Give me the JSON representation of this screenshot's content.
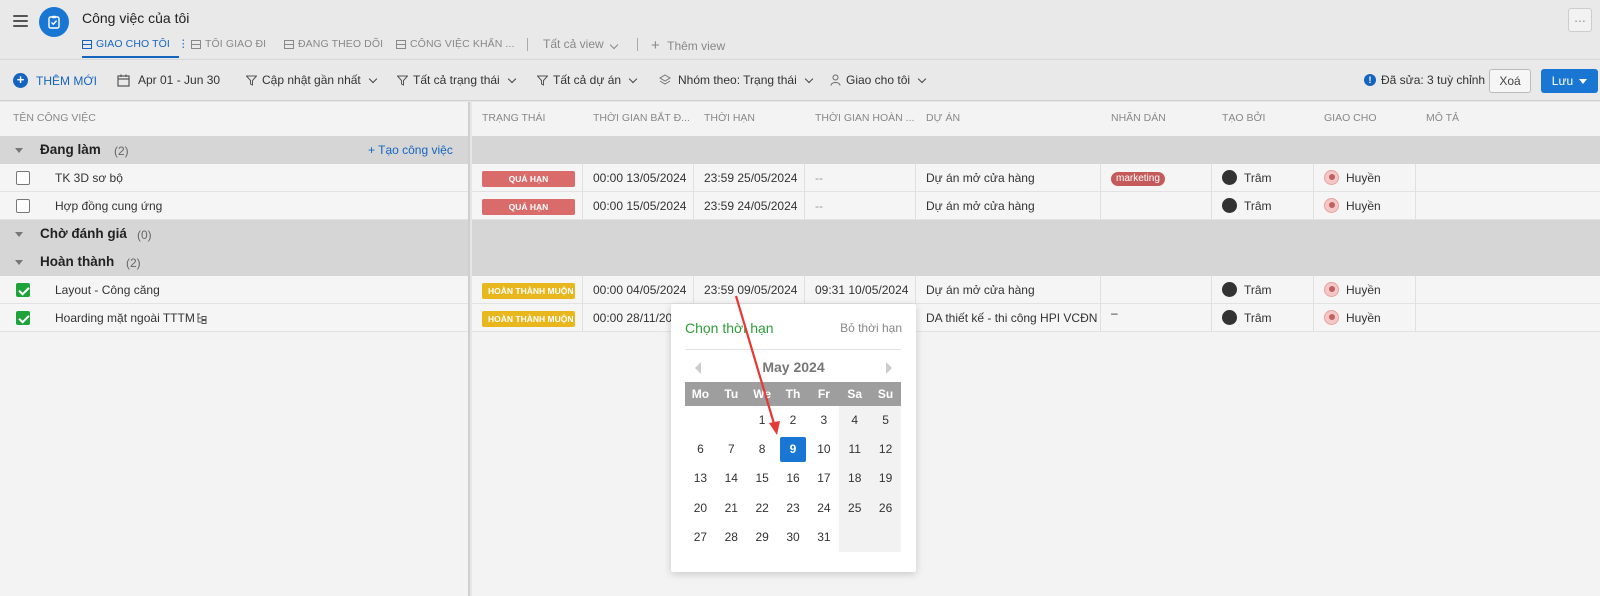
{
  "header": {
    "title": "Công việc của tôi",
    "tabs": [
      "GIAO CHO TÔI",
      "TÔI GIAO ĐI",
      "ĐANG THEO DÕI",
      "CÔNG VIỆC KHẨN ..."
    ],
    "all_views": "Tất cả view",
    "add_view": "Thêm view",
    "more": "..."
  },
  "toolbar": {
    "add_new": "THÊM MỚI",
    "date_range": "Apr 01 - Jun 30",
    "sort": "Cập nhật gần nhất",
    "status_filter": "Tất cả trạng thái",
    "project_filter": "Tất cả dự án",
    "group_by": "Nhóm theo: Trạng thái",
    "assign_filter": "Giao cho tôi",
    "edited": "Đã sửa: 3 tuỳ chỉnh",
    "delete": "Xoá",
    "save": "Lưu"
  },
  "columns": {
    "task_name": "TÊN CÔNG VIỆC",
    "status": "TRẠNG THÁI",
    "start": "THỜI GIAN BẮT Đ...",
    "deadline": "THỜI HẠN",
    "completed": "THỜI GIAN HOÀN ...",
    "project": "DỰ ÁN",
    "label": "NHÃN DÁN",
    "created_by": "TẠO BỞI",
    "assignee": "GIAO CHO",
    "description": "MÔ TẢ"
  },
  "groups": [
    {
      "name": "Đang làm",
      "count": "(2)",
      "create": "+ Tạo công việc",
      "tasks": [
        {
          "name": "TK 3D sơ bộ",
          "done": false,
          "status": "QUÁ HẠN",
          "start": "00:00 13/05/2024",
          "deadline": "23:59 25/05/2024",
          "completed": "--",
          "project": "Dự án mở cửa hàng",
          "label": "marketing",
          "created_by": "Trâm",
          "assignee": "Huyền"
        },
        {
          "name": "Hợp đồng cung ứng",
          "done": false,
          "status": "QUÁ HẠN",
          "start": "00:00 15/05/2024",
          "deadline": "23:59 24/05/2024",
          "completed": "--",
          "project": "Dự án mở cửa hàng",
          "label": "",
          "created_by": "Trâm",
          "assignee": "Huyền"
        }
      ]
    },
    {
      "name": "Chờ đánh giá",
      "count": "(0)",
      "tasks": []
    },
    {
      "name": "Hoàn thành",
      "count": "(2)",
      "tasks": [
        {
          "name": "Layout - Công căng",
          "done": true,
          "status": "HOÀN THÀNH MUỘN",
          "start": "00:00 04/05/2024",
          "deadline": "23:59 09/05/2024",
          "completed": "09:31 10/05/2024",
          "project": "Dự án mở cửa hàng",
          "label": "",
          "created_by": "Trâm",
          "assignee": "Huyền"
        },
        {
          "name": "Hoarding mặt ngoài TTTM",
          "done": true,
          "status": "HOÀN THÀNH MUỘN",
          "start": "00:00 28/11/20",
          "deadline": "",
          "completed": "",
          "project": "DA thiết kế - thi công HPI VCĐN",
          "label": "–",
          "created_by": "Trâm",
          "assignee": "Huyền"
        }
      ]
    }
  ],
  "picker": {
    "title": "Chọn thời hạn",
    "clear": "Bỏ thời hạn",
    "month": "May 2024",
    "weekdays": [
      "Mo",
      "Tu",
      "We",
      "Th",
      "Fr",
      "Sa",
      "Su"
    ],
    "weeks": [
      [
        "",
        "",
        "1",
        "2",
        "3",
        "4",
        "5"
      ],
      [
        "6",
        "7",
        "8",
        "9",
        "10",
        "11",
        "12"
      ],
      [
        "13",
        "14",
        "15",
        "16",
        "17",
        "18",
        "19"
      ],
      [
        "20",
        "21",
        "22",
        "23",
        "24",
        "25",
        "26"
      ],
      [
        "27",
        "28",
        "29",
        "30",
        "31",
        "",
        ""
      ]
    ],
    "selected": "9"
  },
  "colors": {
    "accent": "#1976d2",
    "overdue": "#d96b6b",
    "late": "#e8b71e",
    "done": "#1ea33a",
    "picker_title": "#2e9d3a",
    "arrow": "#e53935"
  }
}
